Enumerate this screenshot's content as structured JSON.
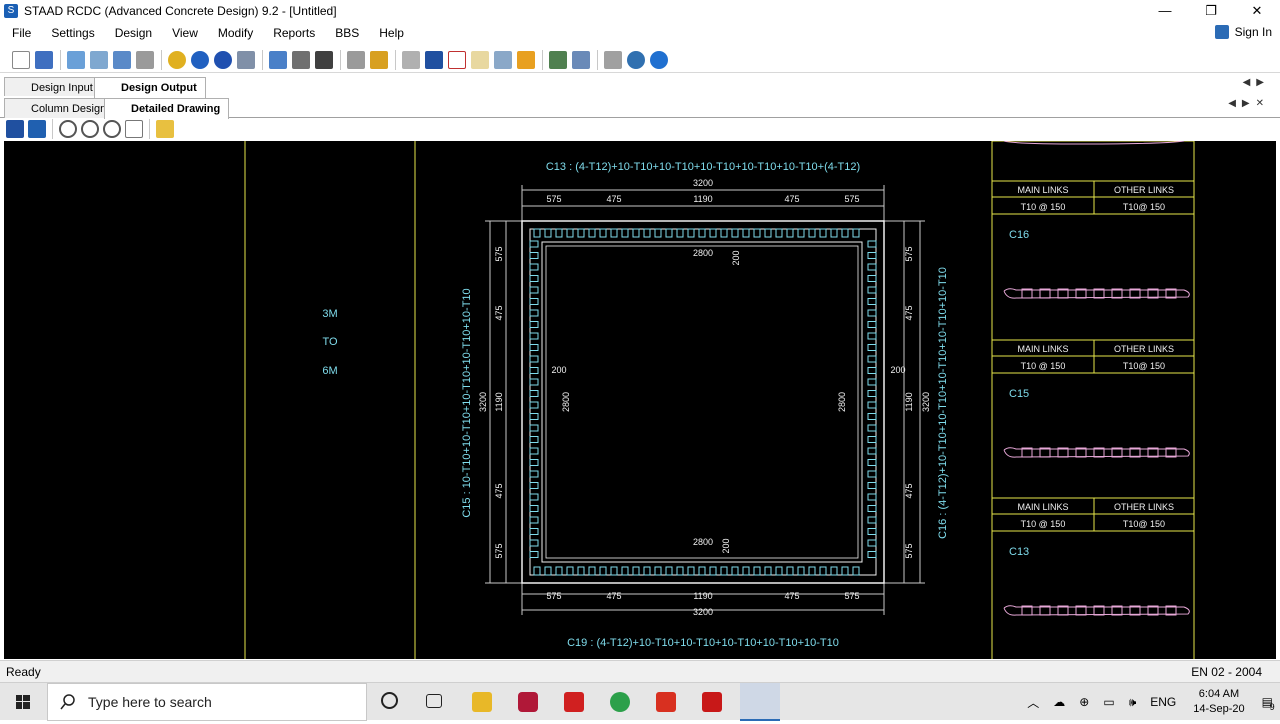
{
  "window": {
    "title": "STAAD RCDC (Advanced Concrete Design) 9.2 - [Untitled]",
    "minimize": "—",
    "restore": "❐",
    "close": "✕"
  },
  "menu": {
    "items": [
      "File",
      "Settings",
      "Design",
      "View",
      "Modify",
      "Reports",
      "BBS",
      "Help"
    ],
    "sign_in": "Sign In"
  },
  "tabs": {
    "top": [
      "Design Input",
      "Design Output"
    ],
    "sub": [
      "Column Design",
      "Detailed Drawing"
    ]
  },
  "drawing": {
    "range": [
      "3M",
      "TO",
      "6M"
    ],
    "top_label": "C13 : (4-T12)+10-T10+10-T10+10-T10+10-T10+10-T10+(4-T12)",
    "bottom_label": "C19 : (4-T12)+10-T10+10-T10+10-T10+10-T10+10-T10",
    "left_label": "C15 : 10-T10+10-T10+10-T10+10-T10+10-T10",
    "right_label": "C16 : (4-T12)+10-T10+10-T10+10-T10+10-T10+10-T10",
    "overall_width": "3200",
    "overall_height": "3200",
    "top_dims": [
      "575",
      "475",
      "1190",
      "475",
      "575"
    ],
    "bottom_dims": [
      "575",
      "475",
      "1190",
      "475",
      "575"
    ],
    "left_dims": [
      "575",
      "475",
      "1190",
      "475",
      "575"
    ],
    "right_dims": [
      "575",
      "475",
      "1190",
      "475",
      "575"
    ],
    "inner_w_top": "2800",
    "inner_w_bottom": "2800",
    "inner_h_left": "2800",
    "inner_h_right": "2800",
    "cover_top": "200",
    "cover_bottom": "200",
    "cover_left": "200",
    "cover_right": "200",
    "links": [
      {
        "main": "MAIN LINKS",
        "other": "OTHER LINKS",
        "main_val": "T10 @ 150",
        "other_val": "T10@ 150",
        "column": "C16"
      },
      {
        "main": "MAIN LINKS",
        "other": "OTHER LINKS",
        "main_val": "T10 @ 150",
        "other_val": "T10@ 150",
        "column": "C15"
      },
      {
        "main": "MAIN LINKS",
        "other": "OTHER LINKS",
        "main_val": "T10 @ 150",
        "other_val": "T10@ 150",
        "column": "C13"
      }
    ]
  },
  "status": {
    "left": "Ready",
    "right": "EN 02 - 2004"
  },
  "taskbar": {
    "search_placeholder": "Type here to search",
    "lang": "ENG",
    "time": "6:04 AM",
    "date": "14-Sep-20",
    "notifications": "9"
  },
  "colors": {
    "drawing_bg": "#000000",
    "cyan": "#7fdcec",
    "yellow": "#e6e64a",
    "white": "#f0f0f0",
    "pink": "#e8a8d8"
  }
}
